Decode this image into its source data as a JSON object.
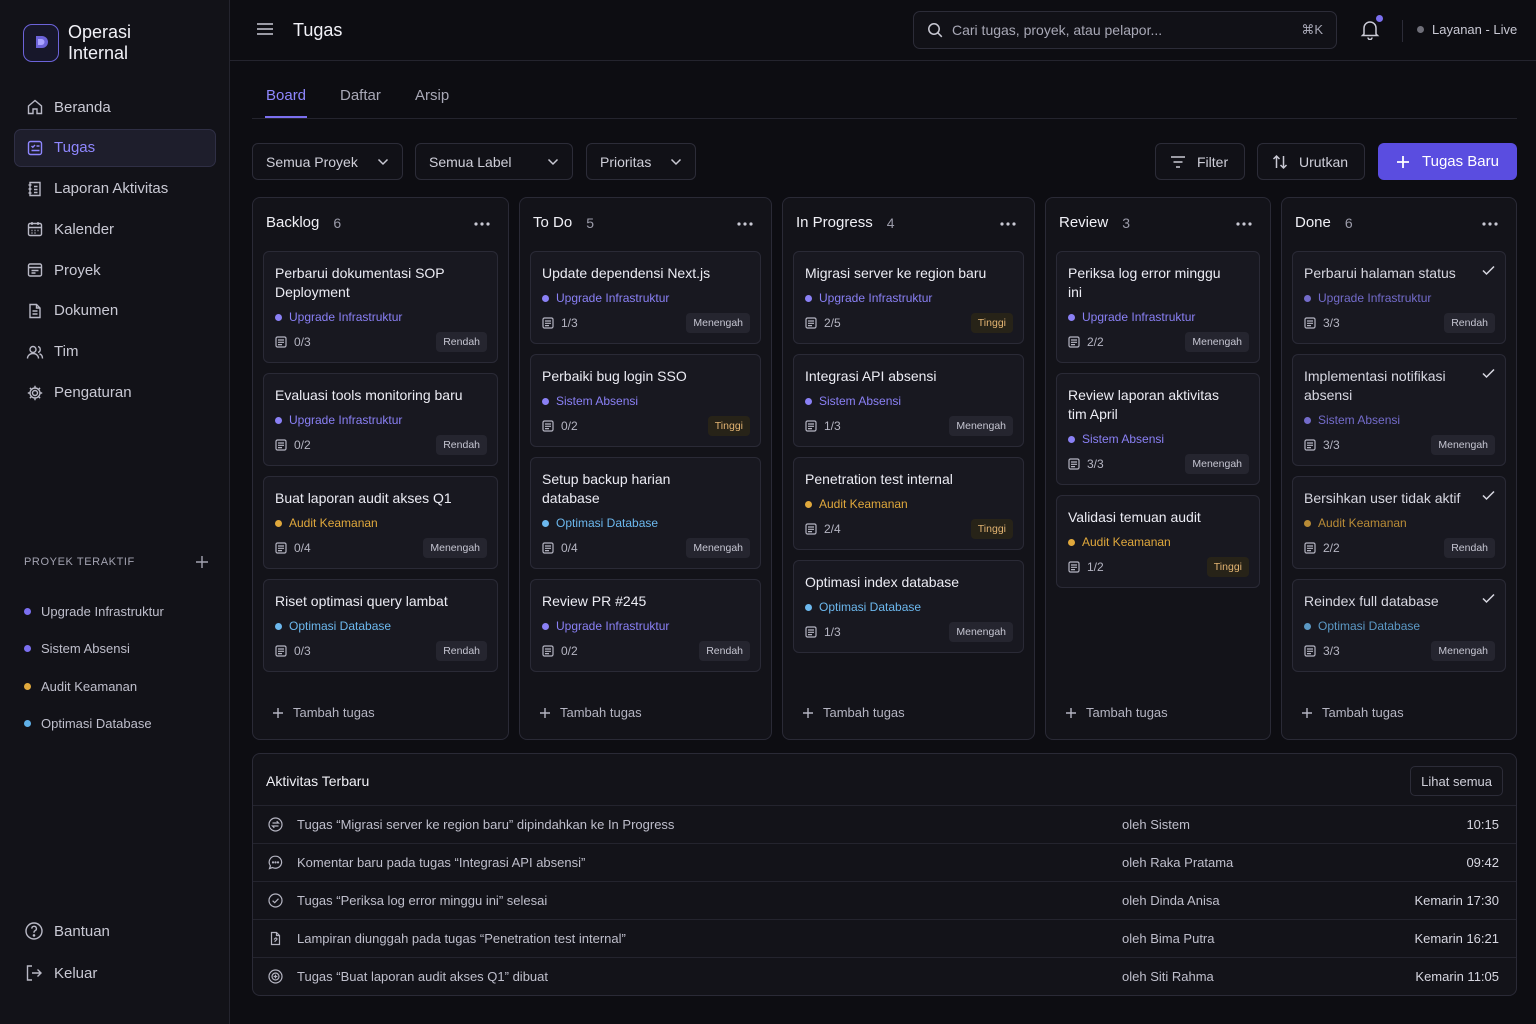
{
  "app": {
    "name_line1": "Operasi",
    "name_line2": "Internal"
  },
  "sidebar": {
    "nav": [
      {
        "label": "Beranda",
        "icon": "home-icon"
      },
      {
        "label": "Tugas",
        "icon": "task-icon",
        "active": true
      },
      {
        "label": "Laporan Aktivitas",
        "icon": "report-icon"
      },
      {
        "label": "Kalender",
        "icon": "calendar-icon"
      },
      {
        "label": "Proyek",
        "icon": "folder-icon"
      },
      {
        "label": "Dokumen",
        "icon": "document-icon"
      },
      {
        "label": "Tim",
        "icon": "users-icon"
      },
      {
        "label": "Pengaturan",
        "icon": "gear-icon"
      }
    ],
    "projects_heading": "PROYEK TERAKTIF",
    "projects": [
      {
        "label": "Upgrade Infrastruktur",
        "color": "#7b6ff0"
      },
      {
        "label": "Sistem Absensi",
        "color": "#7b6ff0"
      },
      {
        "label": "Audit Keamanan",
        "color": "#e0a83c"
      },
      {
        "label": "Optimasi Database",
        "color": "#5fb0e8"
      }
    ],
    "help_label": "Bantuan",
    "logout_label": "Keluar"
  },
  "header": {
    "title": "Tugas",
    "search_placeholder": "Cari tugas, proyek, atau pelapor...",
    "shortcut": "⌘K",
    "status": "Layanan - Live"
  },
  "tabs": [
    "Board",
    "Daftar",
    "Arsip"
  ],
  "toolbar": {
    "filter_project": "Semua Proyek",
    "filter_label": "Semua Label",
    "filter_priority": "Prioritas",
    "filter_button": "Filter",
    "sort_button": "Urutkan",
    "new_task_button": "Tugas Baru"
  },
  "colors": {
    "accent": "#7b6ff0",
    "primary_button": "#5a4de0",
    "priority_high": "#e3b472"
  },
  "columns": [
    {
      "title": "Backlog",
      "count": "6",
      "cards": [
        {
          "title": "Perbarui dokumentasi SOP Deployment",
          "project": "Upgrade Infrastruktur",
          "project_color": "#8a80f5",
          "subtasks": "0/3",
          "priority": "Rendah"
        },
        {
          "title": "Evaluasi tools monitoring baru",
          "project": "Upgrade Infrastruktur",
          "project_color": "#8a80f5",
          "subtasks": "0/2",
          "priority": "Rendah"
        },
        {
          "title": "Buat laporan audit akses Q1",
          "project": "Audit Keamanan",
          "project_color": "#e0a83c",
          "subtasks": "0/4",
          "priority": "Menengah"
        },
        {
          "title": "Riset optimasi query lambat",
          "project": "Optimasi Database",
          "project_color": "#6cb8ee",
          "subtasks": "0/3",
          "priority": "Rendah"
        }
      ],
      "add_label": "Tambah tugas"
    },
    {
      "title": "To Do",
      "count": "5",
      "cards": [
        {
          "title": "Update dependensi Next.js",
          "project": "Upgrade Infrastruktur",
          "project_color": "#8a80f5",
          "subtasks": "1/3",
          "priority": "Menengah"
        },
        {
          "title": "Perbaiki bug login SSO",
          "project": "Sistem Absensi",
          "project_color": "#8a80f5",
          "subtasks": "0/2",
          "priority": "Tinggi"
        },
        {
          "title": "Setup backup harian database",
          "project": "Optimasi Database",
          "project_color": "#6cb8ee",
          "subtasks": "0/4",
          "priority": "Menengah"
        },
        {
          "title": "Review PR #245",
          "project": "Upgrade Infrastruktur",
          "project_color": "#8a80f5",
          "subtasks": "0/2",
          "priority": "Rendah"
        }
      ],
      "add_label": "Tambah tugas"
    },
    {
      "title": "In Progress",
      "count": "4",
      "cards": [
        {
          "title": "Migrasi server ke region baru",
          "project": "Upgrade Infrastruktur",
          "project_color": "#8a80f5",
          "subtasks": "2/5",
          "priority": "Tinggi"
        },
        {
          "title": "Integrasi API absensi",
          "project": "Sistem Absensi",
          "project_color": "#8a80f5",
          "subtasks": "1/3",
          "priority": "Menengah"
        },
        {
          "title": "Penetration test internal",
          "project": "Audit Keamanan",
          "project_color": "#e0a83c",
          "subtasks": "2/4",
          "priority": "Tinggi"
        },
        {
          "title": "Optimasi index database",
          "project": "Optimasi Database",
          "project_color": "#6cb8ee",
          "subtasks": "1/3",
          "priority": "Menengah"
        }
      ],
      "add_label": "Tambah tugas"
    },
    {
      "title": "Review",
      "count": "3",
      "cards": [
        {
          "title": "Periksa log error minggu ini",
          "project": "Upgrade Infrastruktur",
          "project_color": "#8a80f5",
          "subtasks": "2/2",
          "priority": "Menengah"
        },
        {
          "title": "Review laporan aktivitas tim April",
          "project": "Sistem Absensi",
          "project_color": "#8a80f5",
          "subtasks": "3/3",
          "priority": "Menengah"
        },
        {
          "title": "Validasi temuan audit",
          "project": "Audit Keamanan",
          "project_color": "#e0a83c",
          "subtasks": "1/2",
          "priority": "Tinggi"
        }
      ],
      "add_label": "Tambah tugas"
    },
    {
      "title": "Done",
      "count": "6",
      "cards": [
        {
          "title": "Perbarui halaman status",
          "project": "Upgrade Infrastruktur",
          "project_color": "#8a80f5",
          "subtasks": "3/3",
          "priority": "Rendah",
          "done": true
        },
        {
          "title": "Implementasi notifikasi absensi",
          "project": "Sistem Absensi",
          "project_color": "#8a80f5",
          "subtasks": "3/3",
          "priority": "Menengah",
          "done": true
        },
        {
          "title": "Bersihkan user tidak aktif",
          "project": "Audit Keamanan",
          "project_color": "#e0a83c",
          "subtasks": "2/2",
          "priority": "Rendah",
          "done": true
        },
        {
          "title": "Reindex full database",
          "project": "Optimasi Database",
          "project_color": "#6cb8ee",
          "subtasks": "3/3",
          "priority": "Menengah",
          "done": true
        }
      ],
      "add_label": "Tambah tugas"
    }
  ],
  "activity": {
    "title": "Aktivitas Terbaru",
    "see_all": "Lihat semua",
    "rows": [
      {
        "icon": "move-icon",
        "text": "Tugas “Migrasi server ke region baru” dipindahkan ke In Progress",
        "by": "oleh Sistem",
        "time": "10:15"
      },
      {
        "icon": "comment-icon",
        "text": "Komentar baru pada tugas “Integrasi API absensi”",
        "by": "oleh Raka Pratama",
        "time": "09:42"
      },
      {
        "icon": "check-circle-icon",
        "text": "Tugas “Periksa log error minggu ini” selesai",
        "by": "oleh Dinda Anisa",
        "time": "Kemarin 17:30"
      },
      {
        "icon": "attachment-icon",
        "text": "Lampiran diunggah pada tugas “Penetration test internal”",
        "by": "oleh Bima Putra",
        "time": "Kemarin 16:21"
      },
      {
        "icon": "plus-circle-icon",
        "text": "Tugas “Buat laporan audit akses Q1” dibuat",
        "by": "oleh Siti Rahma",
        "time": "Kemarin 11:05"
      }
    ]
  }
}
